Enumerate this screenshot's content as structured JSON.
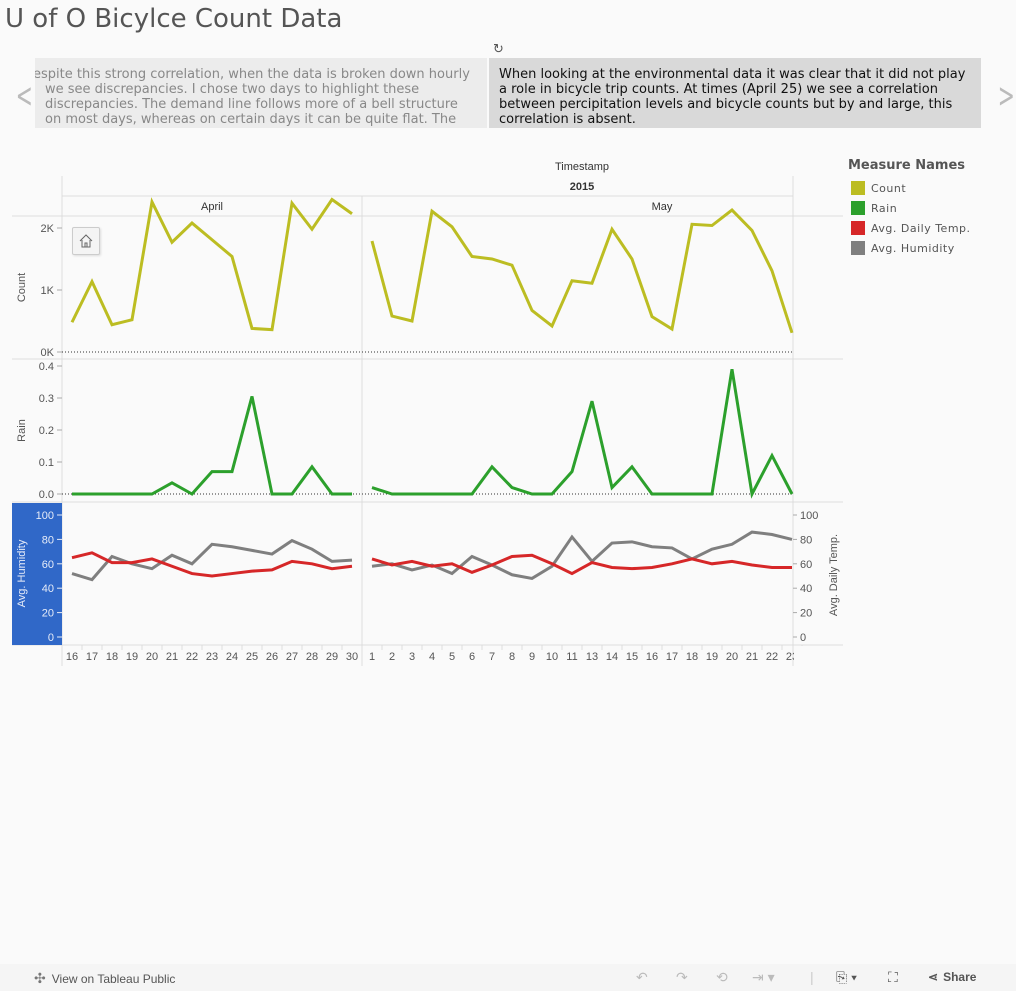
{
  "title": "U of O Bicylce Count Data",
  "story": {
    "prev_text": "Despite this strong correlation, when the data is broken down hourly we see discrepancies. I chose two days to highlight these discrepancies. The demand line follows more of a bell structure on most days, whereas on certain days it can be quite flat. The most obvious explanation is that",
    "current_text": "When looking at the environmental data it was clear that it did not play a role in bicycle trip counts. At times (April 25) we see a correlation between percipitation levels and bicycle counts but by and large, this correlation is absent.",
    "icons": [
      "revert-icon",
      "chevron-left-icon",
      "chevron-right-icon"
    ]
  },
  "legend": {
    "title": "Measure Names",
    "items": [
      {
        "label": "Count",
        "color": "#bcbd22"
      },
      {
        "label": "Rain",
        "color": "#2ca02c"
      },
      {
        "label": "Avg. Daily Temp.",
        "color": "#d62728"
      },
      {
        "label": "Avg. Humidity",
        "color": "#7f7f7f"
      }
    ]
  },
  "chart_data": {
    "type": "line",
    "header": {
      "field": "Timestamp",
      "year": "2015",
      "months": [
        "April",
        "May"
      ]
    },
    "x": {
      "April": [
        "16",
        "17",
        "18",
        "19",
        "20",
        "21",
        "22",
        "23",
        "24",
        "25",
        "26",
        "27",
        "28",
        "29",
        "30"
      ],
      "May": [
        "1",
        "2",
        "3",
        "4",
        "5",
        "6",
        "7",
        "8",
        "9",
        "10",
        "11",
        "13",
        "14",
        "15",
        "16",
        "17",
        "18",
        "19",
        "20",
        "21",
        "22",
        "23"
      ]
    },
    "panes": [
      {
        "ylabel": "Count",
        "ylim": [
          0,
          2500
        ],
        "ticks": [
          0,
          1000,
          2000
        ],
        "tick_labels": [
          "0K",
          "1K",
          "2K"
        ],
        "zero_line": true,
        "series": [
          {
            "name": "Count",
            "color": "#bcbd22",
            "April": [
              480,
              1135,
              440,
              520,
              2420,
              1770,
              2080,
              1810,
              1540,
              380,
              360,
              2400,
              1980,
              2460,
              2230
            ],
            "May": [
              1790,
              580,
              500,
              2270,
              2020,
              1540,
              1500,
              1400,
              670,
              420,
              1150,
              1110,
              1980,
              1500,
              570,
              370,
              2060,
              2040,
              2290,
              1960,
              1310,
              310
            ]
          }
        ]
      },
      {
        "ylabel": "Rain",
        "ylim": [
          0,
          0.4
        ],
        "ticks": [
          0,
          0.1,
          0.2,
          0.3,
          0.4
        ],
        "tick_labels": [
          "0.0",
          "0.1",
          "0.2",
          "0.3",
          "0.4"
        ],
        "zero_line": true,
        "series": [
          {
            "name": "Rain",
            "color": "#2ca02c",
            "April": [
              0,
              0,
              0,
              0,
              0,
              0.035,
              0,
              0.07,
              0.07,
              0.305,
              0,
              0,
              0.085,
              0,
              0
            ],
            "May": [
              0.02,
              0,
              0,
              0,
              0,
              0,
              0.085,
              0.02,
              0,
              0,
              0.07,
              0.29,
              0.02,
              0.085,
              0,
              0,
              0,
              0,
              0.39,
              0,
              0.12,
              0
            ]
          }
        ]
      },
      {
        "ylabel": "Avg. Humidity",
        "ylabel_right": "Avg. Daily Temp.",
        "ylim": [
          0,
          108
        ],
        "ticks": [
          0,
          20,
          40,
          60,
          80,
          100
        ],
        "tick_labels": [
          "0",
          "20",
          "40",
          "60",
          "80",
          "100"
        ],
        "zero_line": false,
        "series": [
          {
            "name": "Avg. Humidity",
            "color": "#7f7f7f",
            "April": [
              52,
              47,
              66,
              60,
              56,
              67,
              60,
              76,
              74,
              71,
              68,
              79,
              72,
              62,
              63
            ],
            "May": [
              58,
              60,
              55,
              59,
              52,
              66,
              59,
              51,
              48,
              58,
              82,
              62,
              77,
              78,
              74,
              73,
              64,
              72,
              76,
              86,
              84,
              80
            ]
          },
          {
            "name": "Avg. Daily Temp.",
            "color": "#d62728",
            "April": [
              65,
              69,
              61,
              61,
              64,
              58,
              52,
              50,
              52,
              54,
              55,
              62,
              60,
              56,
              58
            ],
            "May": [
              64,
              59,
              62,
              58,
              60,
              53,
              59,
              66,
              67,
              60,
              52,
              61,
              57,
              56,
              57,
              60,
              64,
              60,
              62,
              59,
              57,
              57
            ]
          }
        ]
      }
    ],
    "grid": false
  },
  "footer": {
    "view_label": "View on Tableau Public",
    "share_label": "Share",
    "icons": [
      "tableau-logo-icon",
      "undo-icon",
      "redo-icon",
      "revert-icon",
      "refresh-icon",
      "download-icon",
      "fullscreen-icon",
      "share-icon"
    ]
  }
}
